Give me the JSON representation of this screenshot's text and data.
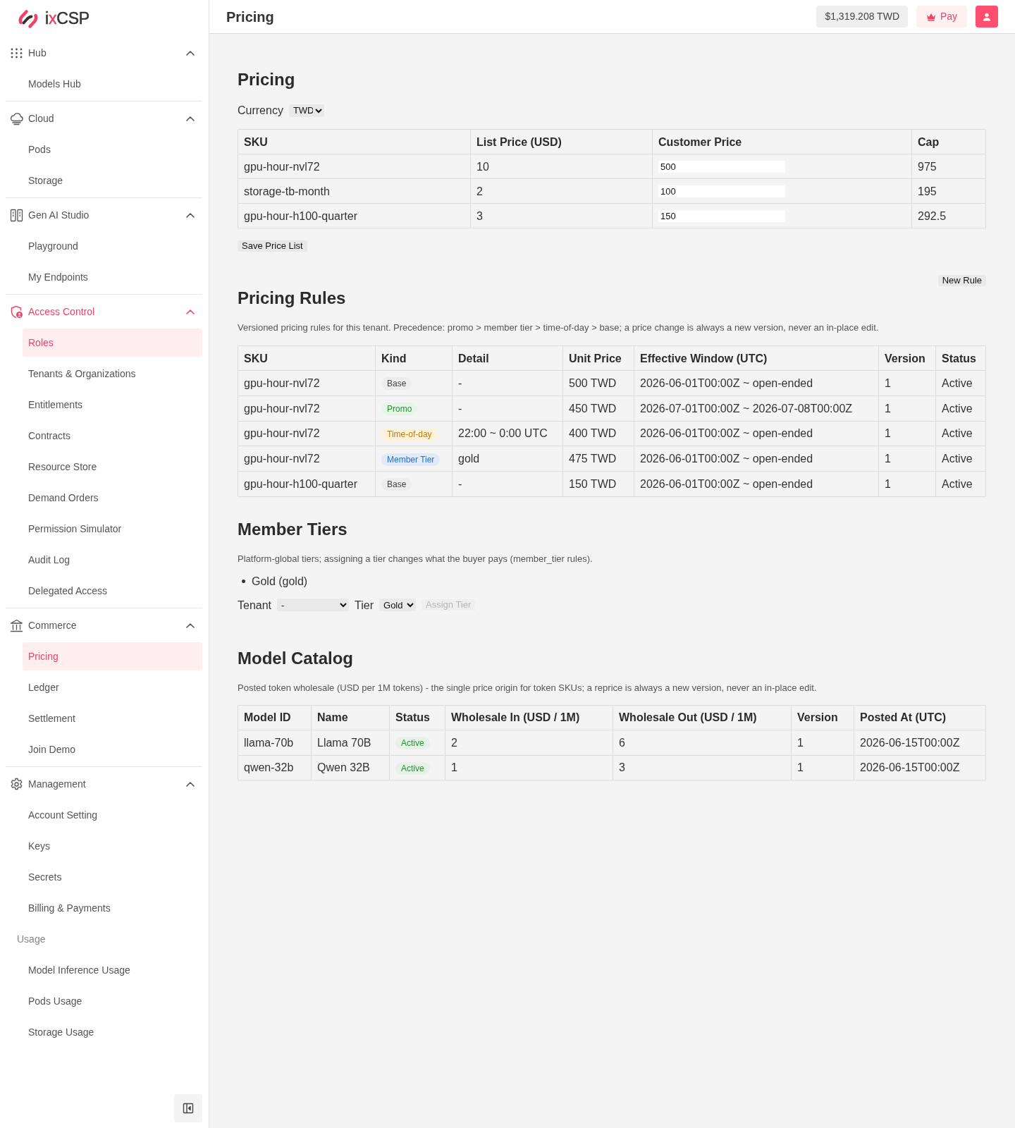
{
  "sidebar": {
    "brand": [
      {
        "text": "i",
        "accent": false
      },
      {
        "text": "x",
        "accent": true
      },
      {
        "text": "CSP",
        "accent": false
      }
    ],
    "groups": [
      {
        "label": "Hub",
        "expanded": true,
        "active": false,
        "items": [
          {
            "label": "Models Hub",
            "selected": false
          }
        ]
      },
      {
        "label": "Cloud",
        "expanded": true,
        "active": false,
        "items": [
          {
            "label": "Pods",
            "selected": false
          },
          {
            "label": "Storage",
            "selected": false
          }
        ]
      },
      {
        "label": "Gen AI Studio",
        "expanded": true,
        "active": false,
        "items": [
          {
            "label": "Playground",
            "selected": false
          },
          {
            "label": "My Endpoints",
            "selected": false
          }
        ]
      },
      {
        "label": "Access Control",
        "expanded": true,
        "active": true,
        "items": [
          {
            "label": "Roles",
            "selected": true
          },
          {
            "label": "Tenants & Organizations",
            "selected": false
          },
          {
            "label": "Entitlements",
            "selected": false
          },
          {
            "label": "Contracts",
            "selected": false
          },
          {
            "label": "Resource Store",
            "selected": false
          },
          {
            "label": "Demand Orders",
            "selected": false
          },
          {
            "label": "Permission Simulator",
            "selected": false
          },
          {
            "label": "Audit Log",
            "selected": false
          },
          {
            "label": "Delegated Access",
            "selected": false
          }
        ]
      },
      {
        "label": "Commerce",
        "expanded": true,
        "active": false,
        "items": [
          {
            "label": "Pricing",
            "selected": true
          },
          {
            "label": "Ledger",
            "selected": false
          },
          {
            "label": "Settlement",
            "selected": false
          },
          {
            "label": "Join Demo",
            "selected": false
          }
        ]
      },
      {
        "label": "Management",
        "expanded": true,
        "active": false,
        "items": [
          {
            "label": "Account Setting",
            "selected": false
          },
          {
            "label": "Keys",
            "selected": false
          },
          {
            "label": "Secrets",
            "selected": false
          },
          {
            "label": "Billing & Payments",
            "selected": false
          }
        ],
        "sections": [
          {
            "label": "Usage",
            "items": [
              {
                "label": "Model Inference Usage",
                "selected": false
              },
              {
                "label": "Pods Usage",
                "selected": false
              },
              {
                "label": "Storage Usage",
                "selected": false
              }
            ]
          }
        ]
      }
    ]
  },
  "header": {
    "title": "Pricing",
    "balance": "$1,319.208 TWD",
    "pay_button": "Pay"
  },
  "pricing": {
    "title": "Pricing",
    "currency": {
      "label": "Currency",
      "value": "TWD"
    },
    "table": {
      "columns": [
        "SKU",
        "List Price (USD)",
        "Customer Price",
        "Cap"
      ],
      "rows": [
        {
          "sku": "gpu-hour-nvl72",
          "list_price": "10",
          "customer_price": "500",
          "cap": "975"
        },
        {
          "sku": "storage-tb-month",
          "list_price": "2",
          "customer_price": "100",
          "cap": "195"
        },
        {
          "sku": "gpu-hour-h100-quarter",
          "list_price": "3",
          "customer_price": "150",
          "cap": "292.5"
        }
      ]
    },
    "save_button": "Save Price List"
  },
  "pricing_rules": {
    "new_rule_button": "New Rule",
    "title": "Pricing Rules",
    "description": "Versioned pricing rules for this tenant. Precedence: promo > member tier > time-of-day > base; a price change is always a new version, never an in-place edit.",
    "table": {
      "columns": [
        "SKU",
        "Kind",
        "Detail",
        "Unit Price",
        "Effective Window (UTC)",
        "Version",
        "Status"
      ],
      "rows": [
        {
          "sku": "gpu-hour-nvl72",
          "kind": {
            "label": "Base",
            "color": "#444444"
          },
          "detail": "-",
          "unit_price": "500 TWD",
          "effective_window": "2026-06-01T00:00Z ~ open-ended",
          "version": "1",
          "status": "Active"
        },
        {
          "sku": "gpu-hour-nvl72",
          "kind": {
            "label": "Promo",
            "color": "#2e8b3a"
          },
          "detail": "-",
          "unit_price": "450 TWD",
          "effective_window": "2026-07-01T00:00Z ~ 2026-07-08T00:00Z",
          "version": "1",
          "status": "Active"
        },
        {
          "sku": "gpu-hour-nvl72",
          "kind": {
            "label": "Time-of-day",
            "color": "#c27c00"
          },
          "detail": "22:00 ~ 0:00 UTC",
          "unit_price": "400 TWD",
          "effective_window": "2026-06-01T00:00Z ~ open-ended",
          "version": "1",
          "status": "Active"
        },
        {
          "sku": "gpu-hour-nvl72",
          "kind": {
            "label": "Member Tier",
            "color": "#2370d4"
          },
          "detail": "gold",
          "unit_price": "475 TWD",
          "effective_window": "2026-06-01T00:00Z ~ open-ended",
          "version": "1",
          "status": "Active"
        },
        {
          "sku": "gpu-hour-h100-quarter",
          "kind": {
            "label": "Base",
            "color": "#444444"
          },
          "detail": "-",
          "unit_price": "150 TWD",
          "effective_window": "2026-06-01T00:00Z ~ open-ended",
          "version": "1",
          "status": "Active"
        }
      ]
    }
  },
  "member_tiers": {
    "title": "Member Tiers",
    "description": "Platform-global tiers; assigning a tier changes what the buyer pays (member_tier rules).",
    "tiers": [
      "Gold (gold)"
    ],
    "tenant": {
      "label": "Tenant",
      "value": "-"
    },
    "tier": {
      "label": "Tier",
      "value": "Gold"
    },
    "assign_button": {
      "label": "Assign Tier",
      "disabled": true
    }
  },
  "model_catalog": {
    "title": "Model Catalog",
    "description": "Posted token wholesale (USD per 1M tokens) - the single price origin for token SKUs; a reprice is always a new version, never an in-place edit.",
    "table": {
      "columns": [
        "Model ID",
        "Name",
        "Status",
        "Wholesale In (USD / 1M)",
        "Wholesale Out (USD / 1M)",
        "Version",
        "Posted At (UTC)"
      ],
      "rows": [
        {
          "model_id": "llama-70b",
          "name": "Llama 70B",
          "status": "Active",
          "wholesale_in": "2",
          "wholesale_out": "6",
          "version": "1",
          "posted_at": "2026-06-15T00:00Z"
        },
        {
          "model_id": "qwen-32b",
          "name": "Qwen 32B",
          "status": "Active",
          "wholesale_in": "1",
          "wholesale_out": "3",
          "version": "1",
          "posted_at": "2026-06-15T00:00Z"
        }
      ]
    }
  }
}
